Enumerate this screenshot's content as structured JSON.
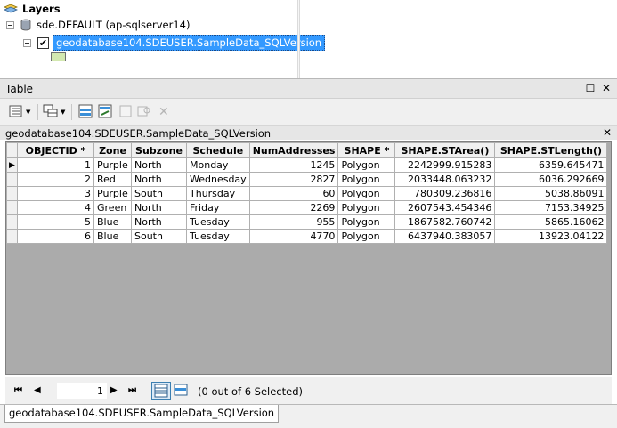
{
  "toc": {
    "layers_label": "Layers",
    "database_label": "sde.DEFAULT (ap-sqlserver14)",
    "layer_label": "geodatabase104.SDEUSER.SampleData_SQLVersion",
    "layer_checked": "✔",
    "symbol_color": "#d3e8b0"
  },
  "window": {
    "title": "Table",
    "maximize_glyph": "☐",
    "close_glyph": "✕"
  },
  "toolbar": {
    "icons": [
      "table-options-icon",
      "related-tables-icon",
      "select-by-attributes-icon",
      "switch-selection-icon",
      "clear-selection-icon",
      "zoom-to-selected-icon",
      "delete-selected-icon"
    ]
  },
  "tab_header": {
    "title": "geodatabase104.SDEUSER.SampleData_SQLVersion",
    "close_glyph": "✕"
  },
  "grid": {
    "columns": [
      "OBJECTID *",
      "Zone",
      "Subzone",
      "Schedule",
      "NumAddresses",
      "SHAPE *",
      "SHAPE.STArea()",
      "SHAPE.STLength()"
    ],
    "rows": [
      [
        "1",
        "Purple",
        "North",
        "Monday",
        "1245",
        "Polygon",
        "2242999.915283",
        "6359.645471"
      ],
      [
        "2",
        "Red",
        "North",
        "Wednesday",
        "2827",
        "Polygon",
        "2033448.063232",
        "6036.292669"
      ],
      [
        "3",
        "Purple",
        "South",
        "Thursday",
        "60",
        "Polygon",
        "780309.236816",
        "5038.86091"
      ],
      [
        "4",
        "Green",
        "North",
        "Friday",
        "2269",
        "Polygon",
        "2607543.454346",
        "7153.34925"
      ],
      [
        "5",
        "Blue",
        "North",
        "Tuesday",
        "955",
        "Polygon",
        "1867582.760742",
        "5865.16062"
      ],
      [
        "6",
        "Blue",
        "South",
        "Tuesday",
        "4770",
        "Polygon",
        "6437940.383057",
        "13923.04122"
      ]
    ],
    "current_row_marker": "▶"
  },
  "status": {
    "first_glyph": "⏮",
    "prev_glyph": "◀",
    "record_value": "1",
    "next_glyph": "▶",
    "last_glyph": "⏭",
    "selection_text": "(0 out of 6 Selected)"
  },
  "bottom_tab": {
    "label": "geodatabase104.SDEUSER.SampleData_SQLVersion"
  }
}
